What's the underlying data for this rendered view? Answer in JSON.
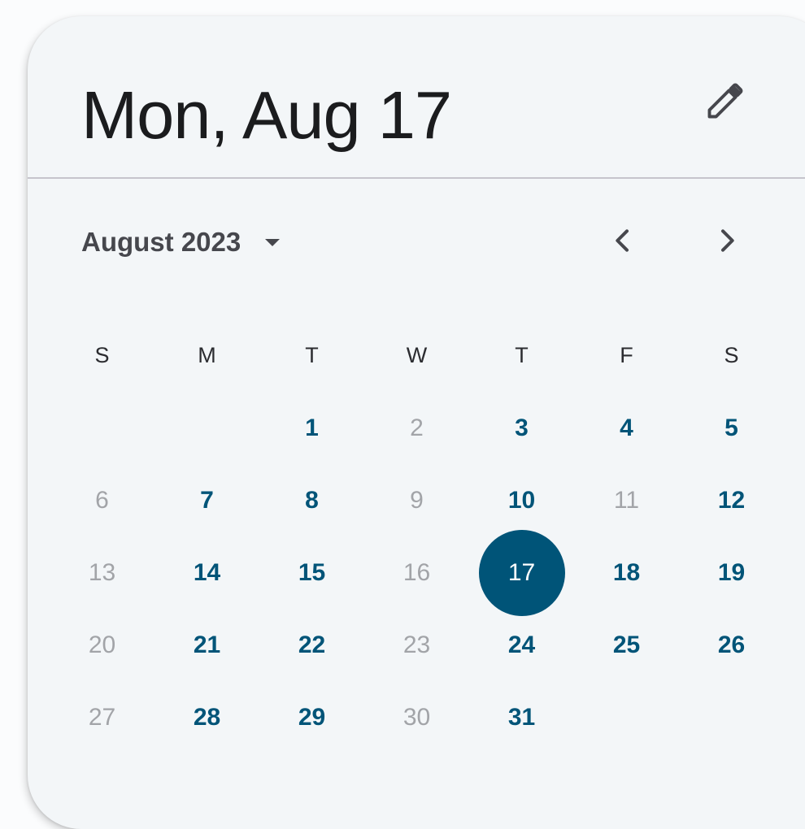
{
  "header": {
    "headline": "Mon, Aug 17",
    "edit_icon": "pencil-icon"
  },
  "nav": {
    "month_label": "August 2023",
    "dropdown_icon": "caret-down-icon",
    "prev_icon": "chevron-left-icon",
    "next_icon": "chevron-right-icon"
  },
  "weekdays": [
    "S",
    "M",
    "T",
    "W",
    "T",
    "F",
    "S"
  ],
  "days": [
    {
      "label": "",
      "state": "empty"
    },
    {
      "label": "",
      "state": "empty"
    },
    {
      "label": "1",
      "state": "enabled"
    },
    {
      "label": "2",
      "state": "muted"
    },
    {
      "label": "3",
      "state": "enabled"
    },
    {
      "label": "4",
      "state": "enabled"
    },
    {
      "label": "5",
      "state": "enabled"
    },
    {
      "label": "6",
      "state": "muted"
    },
    {
      "label": "7",
      "state": "enabled"
    },
    {
      "label": "8",
      "state": "enabled"
    },
    {
      "label": "9",
      "state": "muted"
    },
    {
      "label": "10",
      "state": "enabled"
    },
    {
      "label": "11",
      "state": "muted"
    },
    {
      "label": "12",
      "state": "enabled"
    },
    {
      "label": "13",
      "state": "muted"
    },
    {
      "label": "14",
      "state": "enabled"
    },
    {
      "label": "15",
      "state": "enabled"
    },
    {
      "label": "16",
      "state": "muted"
    },
    {
      "label": "17",
      "state": "selected"
    },
    {
      "label": "18",
      "state": "enabled"
    },
    {
      "label": "19",
      "state": "enabled"
    },
    {
      "label": "20",
      "state": "muted"
    },
    {
      "label": "21",
      "state": "enabled"
    },
    {
      "label": "22",
      "state": "enabled"
    },
    {
      "label": "23",
      "state": "muted"
    },
    {
      "label": "24",
      "state": "enabled"
    },
    {
      "label": "25",
      "state": "enabled"
    },
    {
      "label": "26",
      "state": "enabled"
    },
    {
      "label": "27",
      "state": "muted"
    },
    {
      "label": "28",
      "state": "enabled"
    },
    {
      "label": "29",
      "state": "enabled"
    },
    {
      "label": "30",
      "state": "muted"
    },
    {
      "label": "31",
      "state": "enabled"
    }
  ],
  "colors": {
    "accent": "#005478",
    "muted": "#a2a4a8",
    "surface": "#f3f6f8",
    "divider": "#c6c4cc"
  }
}
